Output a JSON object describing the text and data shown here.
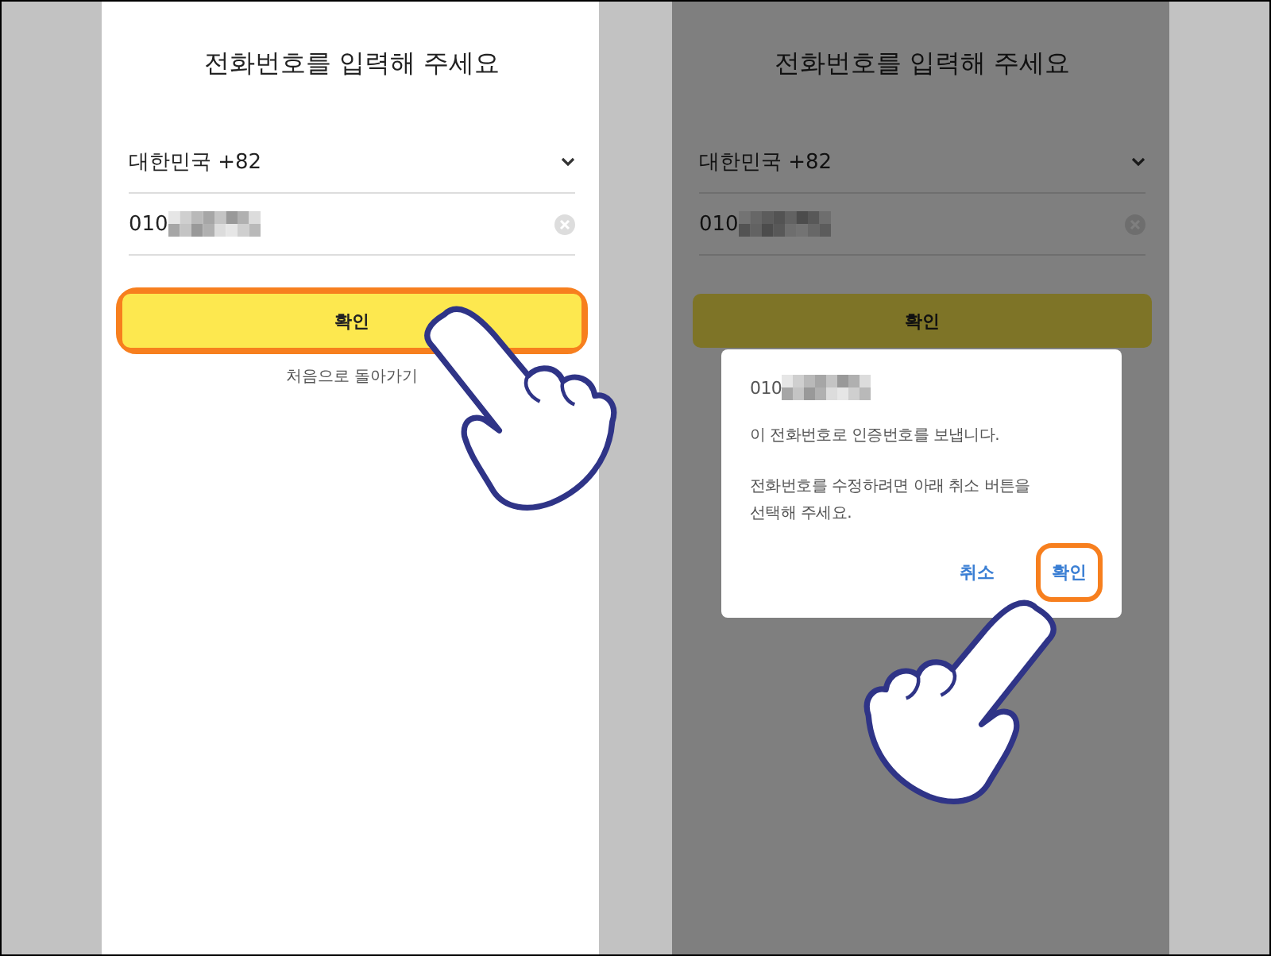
{
  "screens": [
    {
      "title": "전화번호를 입력해 주세요",
      "dimmed": false,
      "country": {
        "value": "대한민국 +82"
      },
      "phone": {
        "value": "010",
        "masked": true
      },
      "confirm_button": {
        "label": "확인",
        "highlighted": true
      },
      "back_link": "처음으로 돌아가기"
    },
    {
      "title": "전화번호를 입력해 주세요",
      "dimmed": true,
      "country": {
        "value": "대한민국 +82"
      },
      "phone": {
        "value": "010",
        "masked": true
      },
      "confirm_button": {
        "label": "확인",
        "highlighted": false
      },
      "dialog": {
        "number": "010",
        "masked": true,
        "message": "이 전화번호로 인증번호를 보냅니다.",
        "hint": "전화번호를 수정하려면 아래 취소 버튼을 선택해 주세요.",
        "buttons": [
          {
            "label": "취소",
            "highlighted": false
          },
          {
            "label": "확인",
            "highlighted": true
          }
        ]
      }
    }
  ]
}
